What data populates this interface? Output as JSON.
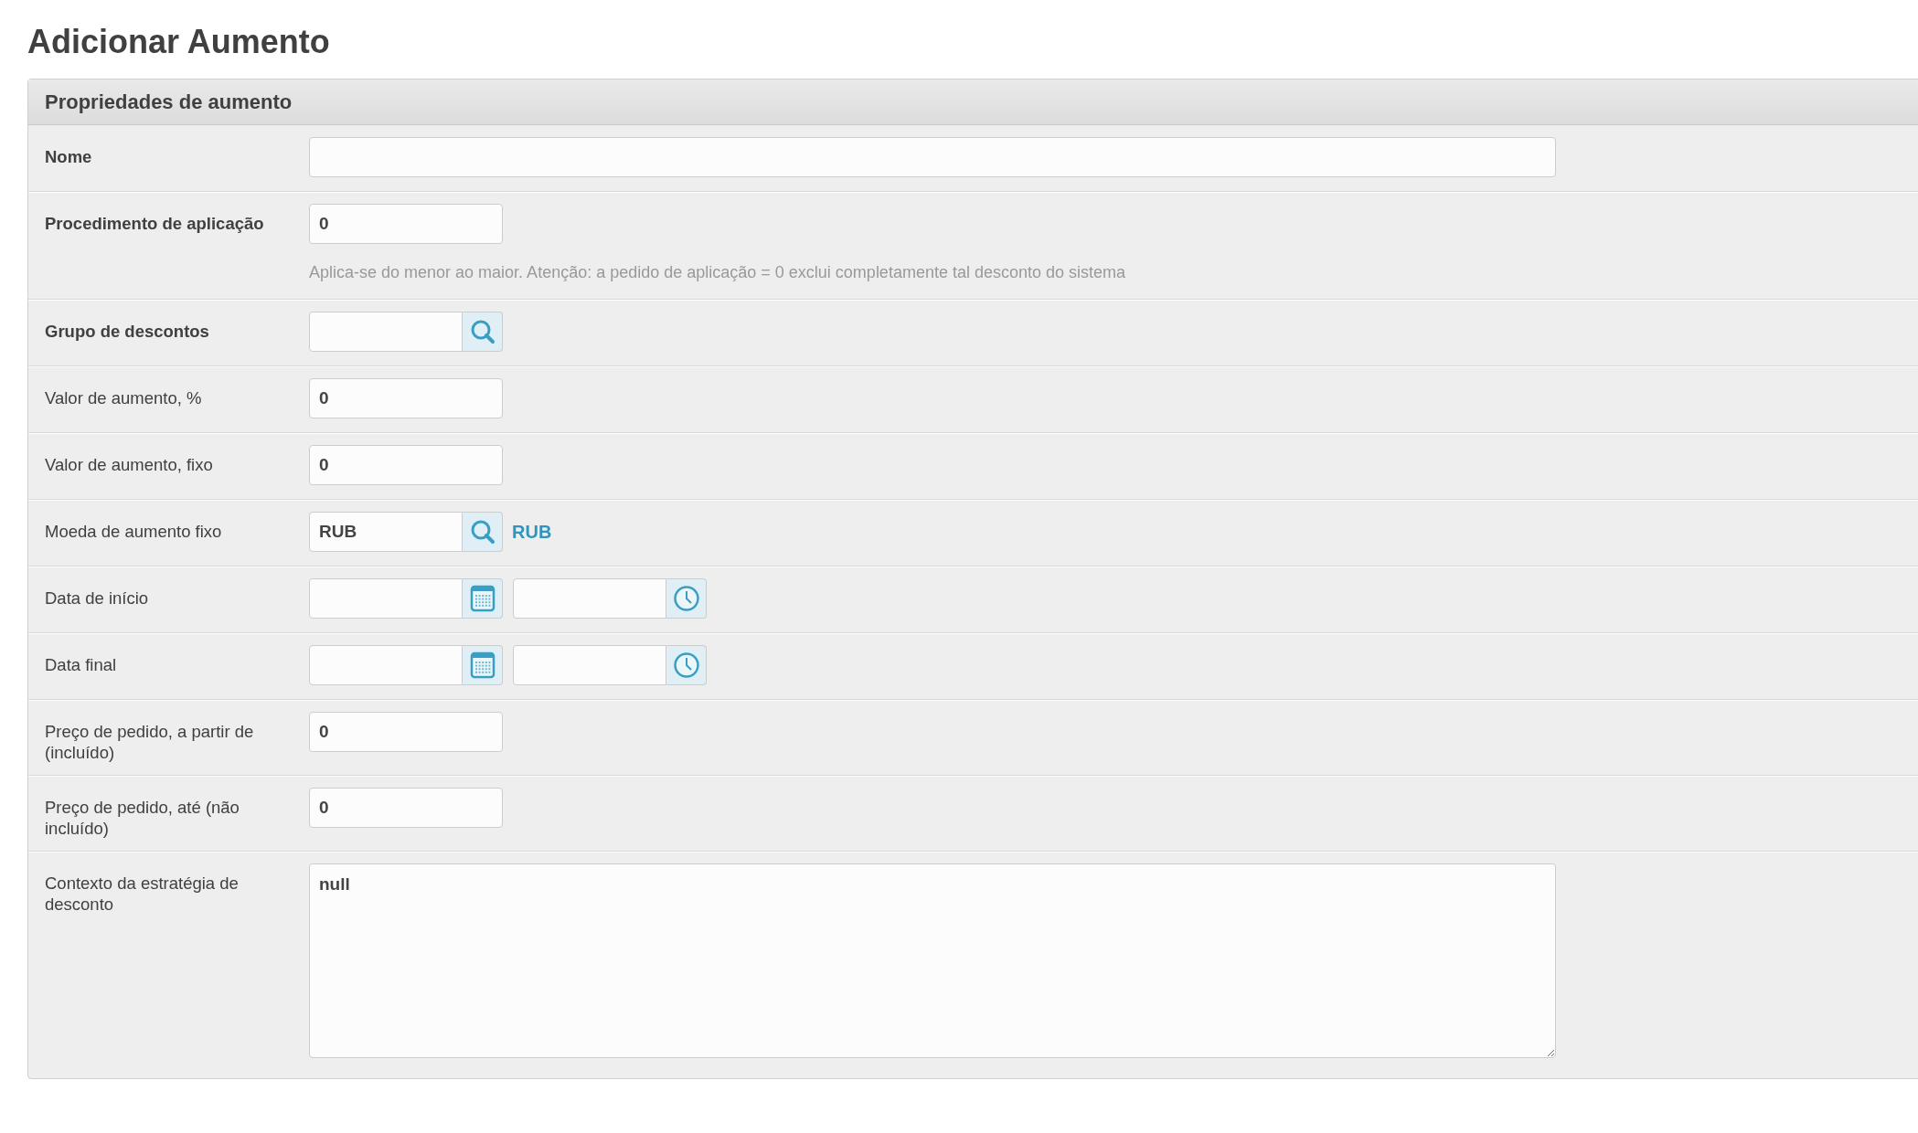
{
  "page_title": "Adicionar Aumento",
  "panel": {
    "title": "Propriedades de aumento",
    "fields": [
      {
        "kind": "text",
        "label": "Nome",
        "required": true,
        "wide": true
      },
      {
        "kind": "text",
        "label": "Procedimento de aplicação",
        "required": true,
        "value": "0",
        "hint": "Aplica-se do menor ao maior. Atenção: a pedido de aplicação = 0 exclui completamente tal desconto do sistema"
      },
      {
        "kind": "lookup",
        "label": "Grupo de descontos",
        "required": true
      },
      {
        "kind": "text",
        "label": "Valor de aumento, %",
        "required": false,
        "value": "0"
      },
      {
        "kind": "text",
        "label": "Valor de aumento, fixo",
        "required": false,
        "value": "0"
      },
      {
        "kind": "lookup",
        "label": "Moeda de aumento fixo",
        "required": false,
        "value": "RUB",
        "resolved": "RUB"
      },
      {
        "kind": "datetime",
        "label": "Data de início",
        "required": false
      },
      {
        "kind": "datetime",
        "label": "Data final",
        "required": false
      },
      {
        "kind": "text",
        "label": "Preço de pedido, a partir de (incluído)",
        "required": false,
        "value": "0"
      },
      {
        "kind": "text",
        "label": "Preço de pedido, até (não incluído)",
        "required": false,
        "value": "0"
      },
      {
        "kind": "textarea",
        "label": "Contexto da estratégia de desconto",
        "required": false,
        "value": "null"
      }
    ]
  }
}
